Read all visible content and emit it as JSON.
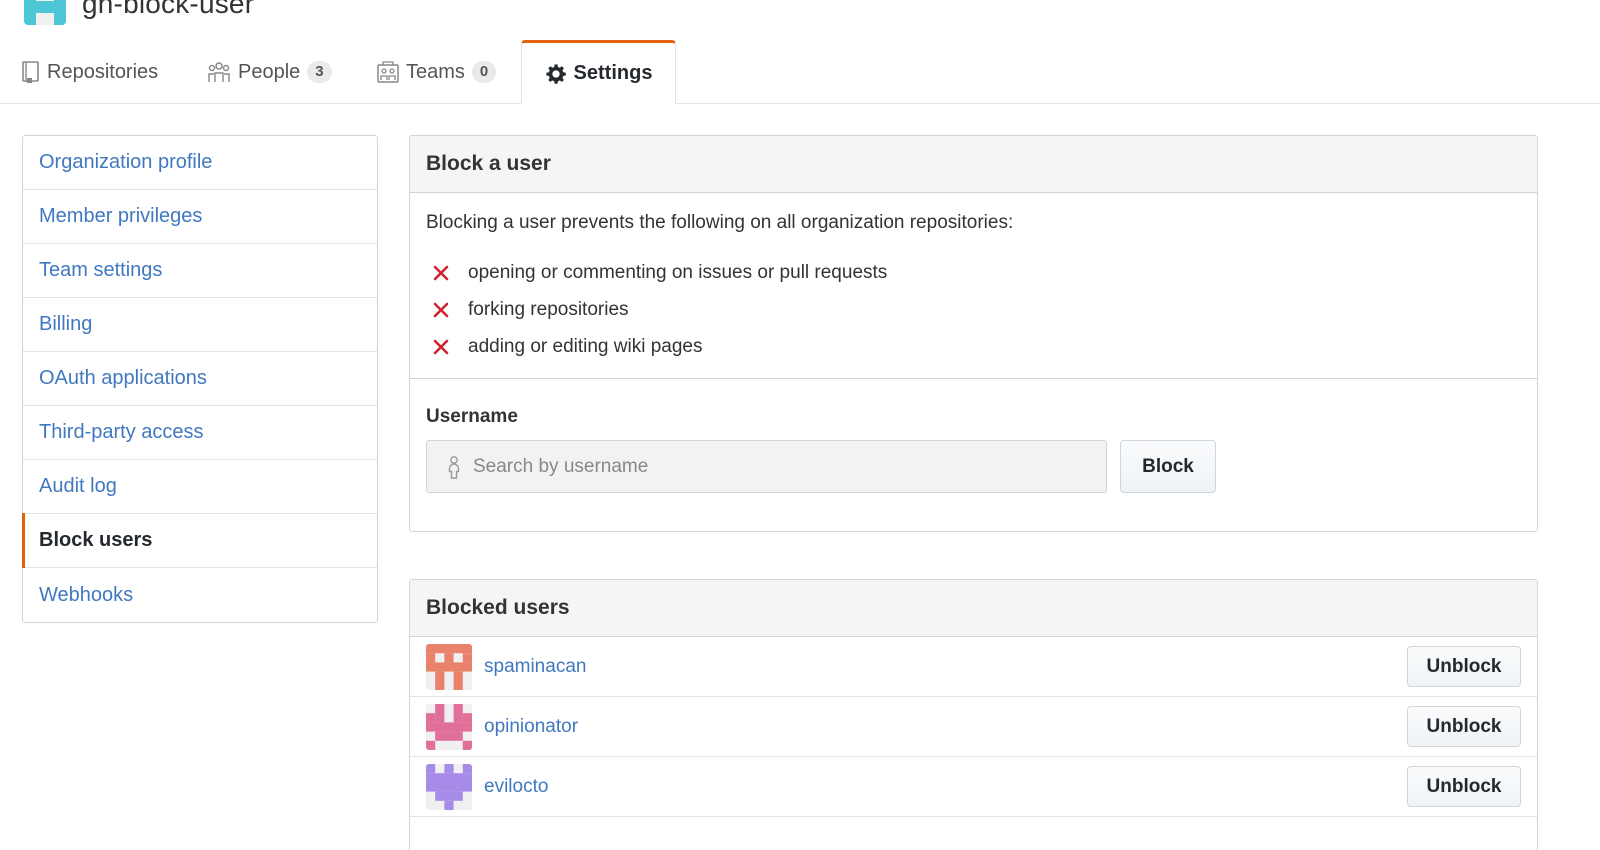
{
  "org": {
    "name": "gh-block-user"
  },
  "tabs": [
    {
      "label": "Repositories",
      "icon": "repo-icon"
    },
    {
      "label": "People",
      "count": "3",
      "icon": "people-icon"
    },
    {
      "label": "Teams",
      "count": "0",
      "icon": "teams-icon"
    },
    {
      "label": "Settings",
      "icon": "gear-icon",
      "selected": true
    }
  ],
  "sidebar": {
    "items": [
      {
        "label": "Organization profile"
      },
      {
        "label": "Member privileges"
      },
      {
        "label": "Team settings"
      },
      {
        "label": "Billing"
      },
      {
        "label": "OAuth applications"
      },
      {
        "label": "Third-party access"
      },
      {
        "label": "Audit log"
      },
      {
        "label": "Block users",
        "selected": true
      },
      {
        "label": "Webhooks"
      }
    ]
  },
  "block_box": {
    "title": "Block a user",
    "intro": "Blocking a user prevents the following on all organization repositories:",
    "restrictions": [
      "opening or commenting on issues or pull requests",
      "forking repositories",
      "adding or editing wiki pages"
    ],
    "username_label": "Username",
    "search_placeholder": "Search by username",
    "search_value": "",
    "block_button": "Block"
  },
  "blocked_box": {
    "title": "Blocked users",
    "users": [
      {
        "username": "spaminacan",
        "avatar_color": "#e8826b"
      },
      {
        "username": "opinionator",
        "avatar_color": "#e0709a"
      },
      {
        "username": "evilocto",
        "avatar_color": "#a68be8"
      }
    ],
    "unblock_label": "Unblock"
  },
  "colors": {
    "link": "#4078c0",
    "accent": "#e36209",
    "danger": "#cb2431",
    "org_avatar": "#4dc7d6"
  }
}
